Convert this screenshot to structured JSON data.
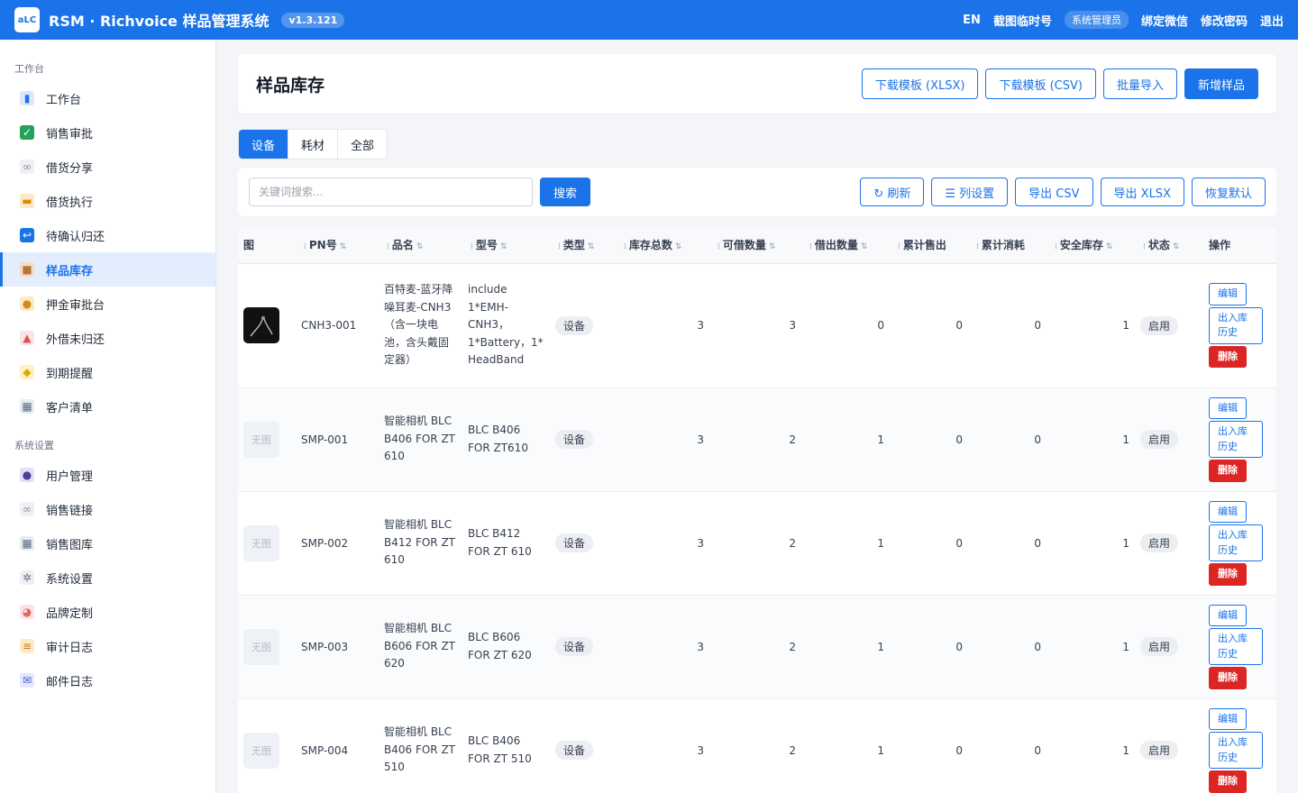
{
  "app": {
    "logo_text": "aLC",
    "title": "RSM · Richvoice 样品管理系统",
    "version": "v1.3.121"
  },
  "topnav": {
    "lang": "EN",
    "screenshot_tag": "截图临时号",
    "role": "系统管理员",
    "bind_wechat": "绑定微信",
    "change_password": "修改密码",
    "logout": "退出"
  },
  "sidebar": {
    "group1": "工作台",
    "items1": [
      {
        "label": "工作台",
        "icon": "dashboard-icon"
      },
      {
        "label": "销售审批",
        "icon": "check-icon"
      },
      {
        "label": "借货分享",
        "icon": "link-icon"
      },
      {
        "label": "借货执行",
        "icon": "truck-icon"
      },
      {
        "label": "待确认归还",
        "icon": "return-icon"
      },
      {
        "label": "样品库存",
        "icon": "box-icon",
        "active": true
      },
      {
        "label": "押金审批台",
        "icon": "money-bag-icon"
      },
      {
        "label": "外借未归还",
        "icon": "outbox-icon"
      },
      {
        "label": "到期提醒",
        "icon": "bell-icon"
      },
      {
        "label": "客户清单",
        "icon": "building-icon"
      }
    ],
    "group2": "系统设置",
    "items2": [
      {
        "label": "用户管理",
        "icon": "users-icon"
      },
      {
        "label": "销售链接",
        "icon": "link-icon"
      },
      {
        "label": "销售图库",
        "icon": "gallery-icon"
      },
      {
        "label": "系统设置",
        "icon": "gear-icon"
      },
      {
        "label": "品牌定制",
        "icon": "palette-icon"
      },
      {
        "label": "审计日志",
        "icon": "scroll-icon"
      },
      {
        "label": "邮件日志",
        "icon": "mail-icon"
      }
    ]
  },
  "page": {
    "title": "样品库存",
    "download_xlsx": "下载模板 (XLSX)",
    "download_csv": "下载模板 (CSV)",
    "bulk_import": "批量导入",
    "add_sample": "新增样品"
  },
  "tabs": [
    {
      "label": "设备",
      "active": true
    },
    {
      "label": "耗材",
      "active": false
    },
    {
      "label": "全部",
      "active": false
    }
  ],
  "toolbar": {
    "search_placeholder": "关键词搜索...",
    "search_button": "搜索",
    "refresh": "↻ 刷新",
    "columns": "☰ 列设置",
    "export_csv": "导出 CSV",
    "export_xlsx": "导出 XLSX",
    "reset": "恢复默认"
  },
  "table": {
    "columns": [
      "图",
      "PN号",
      "品名",
      "型号",
      "类型",
      "库存总数",
      "可借数量",
      "借出数量",
      "累计售出",
      "累计消耗",
      "安全库存",
      "状态",
      "操作"
    ],
    "no_image_text": "无图",
    "rows": [
      {
        "has_image": true,
        "pn": "CNH3-001",
        "name": "百特麦-蓝牙降噪耳麦-CNH3（含一块电池，含头戴固定器）",
        "model": "include 1*EMH-CNH3，1*Battery，1* HeadBand",
        "type": "设备",
        "total": 3,
        "available": 3,
        "lent": 0,
        "sold": 0,
        "consumed": 0,
        "safety": 1,
        "status": "启用"
      },
      {
        "has_image": false,
        "pn": "SMP-001",
        "name": "智能相机 BLC B406 FOR ZT 610",
        "model": "BLC B406 FOR ZT610",
        "type": "设备",
        "total": 3,
        "available": 2,
        "lent": 1,
        "sold": 0,
        "consumed": 0,
        "safety": 1,
        "status": "启用"
      },
      {
        "has_image": false,
        "pn": "SMP-002",
        "name": "智能相机 BLC B412 FOR ZT 610",
        "model": "BLC B412 FOR ZT 610",
        "type": "设备",
        "total": 3,
        "available": 2,
        "lent": 1,
        "sold": 0,
        "consumed": 0,
        "safety": 1,
        "status": "启用"
      },
      {
        "has_image": false,
        "pn": "SMP-003",
        "name": "智能相机 BLC B606 FOR ZT 620",
        "model": "BLC B606 FOR ZT 620",
        "type": "设备",
        "total": 3,
        "available": 2,
        "lent": 1,
        "sold": 0,
        "consumed": 0,
        "safety": 1,
        "status": "启用"
      },
      {
        "has_image": false,
        "pn": "SMP-004",
        "name": "智能相机 BLC B406 FOR ZT 510",
        "model": "BLC B406 FOR ZT 510",
        "type": "设备",
        "total": 3,
        "available": 2,
        "lent": 1,
        "sold": 0,
        "consumed": 0,
        "safety": 1,
        "status": "启用"
      }
    ],
    "ops": {
      "edit": "编辑",
      "history": "出入库历史",
      "delete": "删除"
    }
  }
}
